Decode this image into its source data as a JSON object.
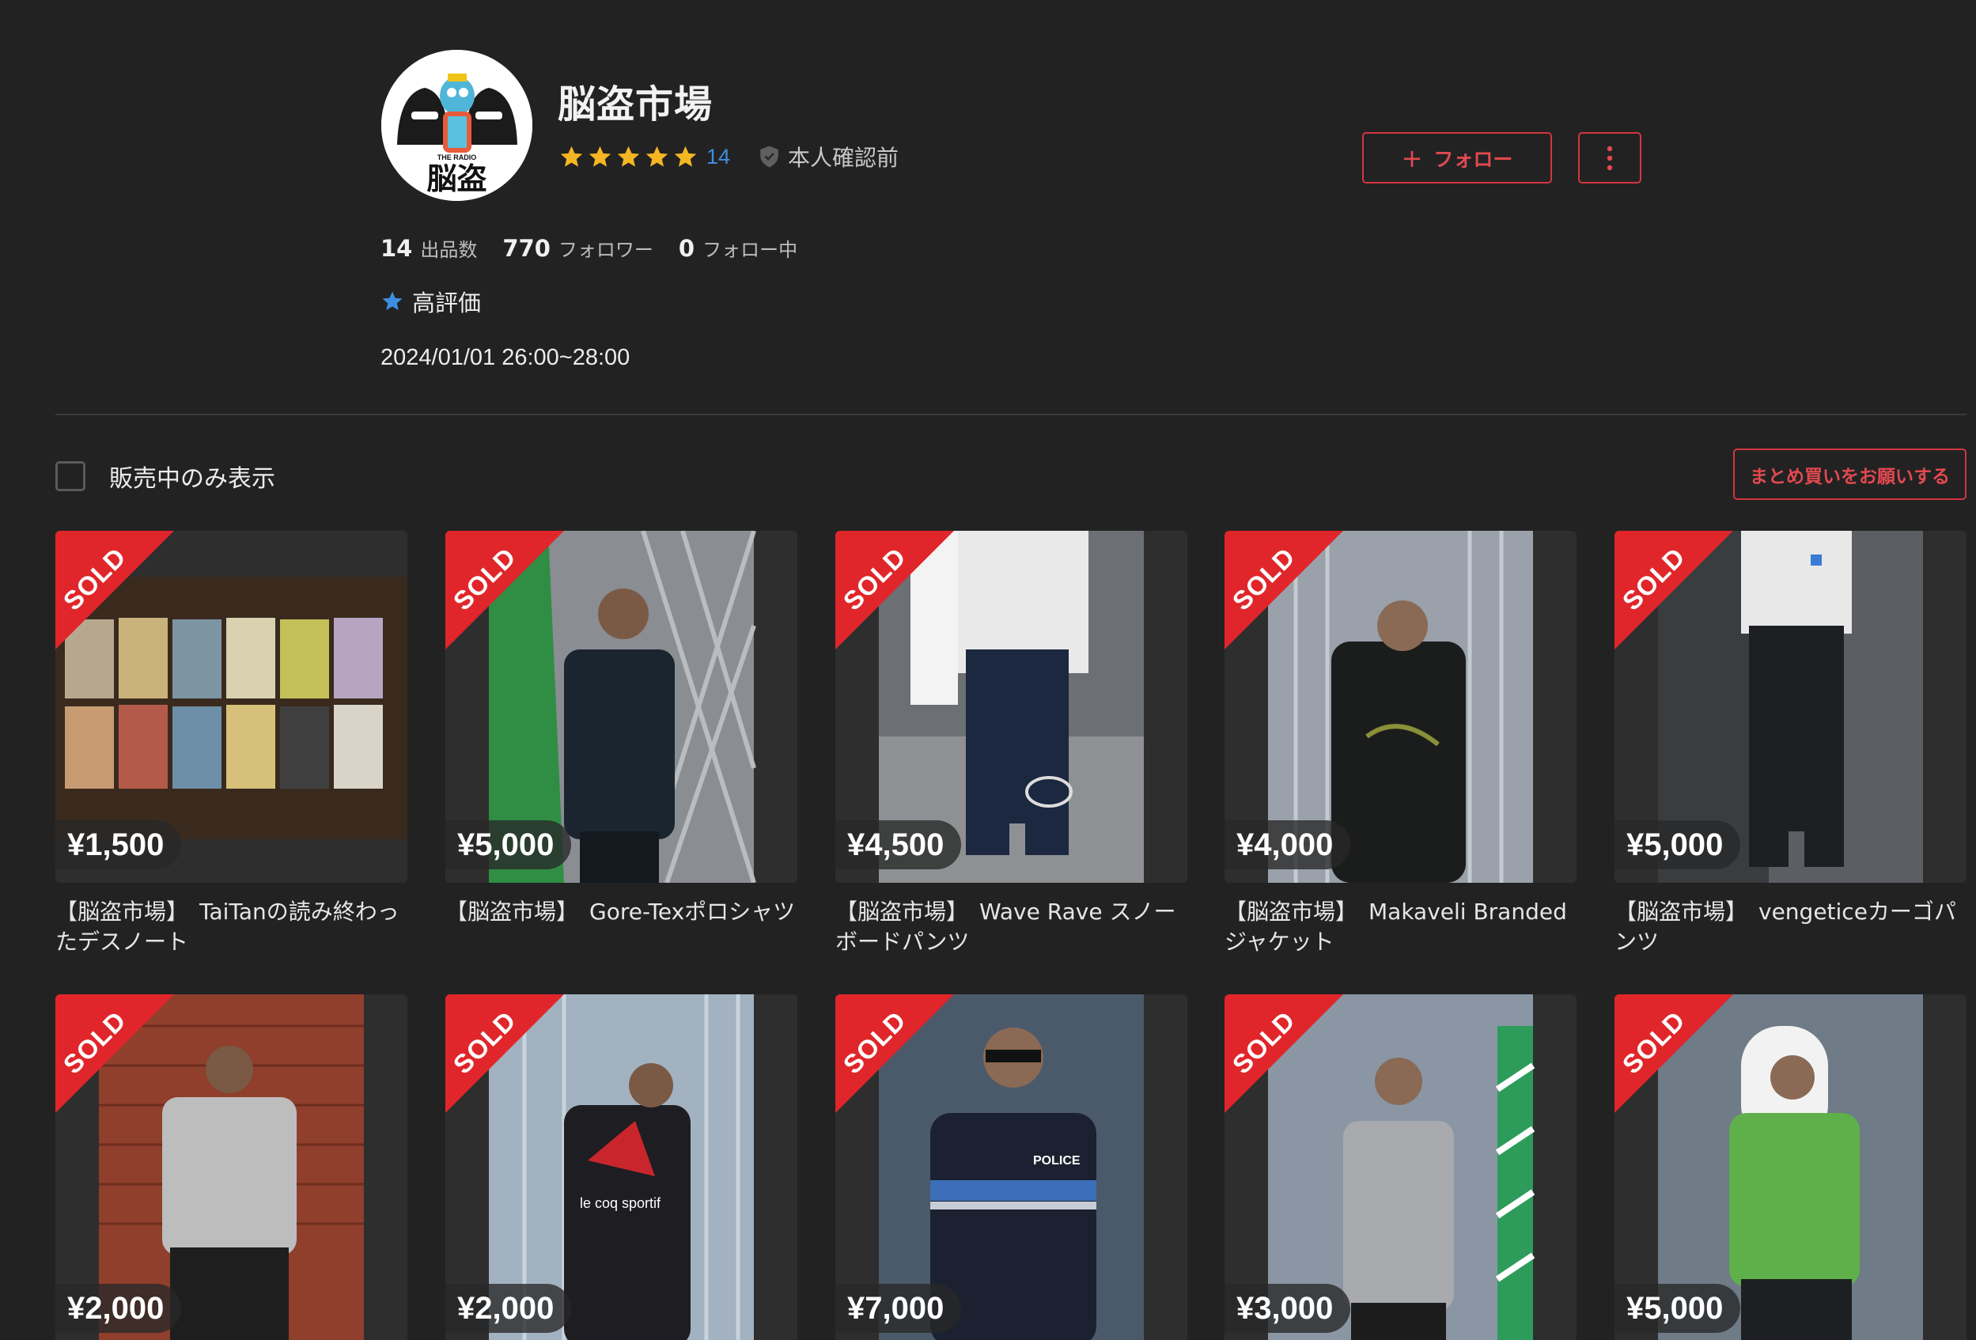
{
  "profile": {
    "name": "脳盗市場",
    "rating_count": "14",
    "verification": "本人確認前",
    "follow_label": "フォロー",
    "stats": [
      {
        "value": "14",
        "label": "出品数"
      },
      {
        "value": "770",
        "label": "フォロワー"
      },
      {
        "value": "0",
        "label": "フォロー中"
      }
    ],
    "badge": "高評価",
    "schedule": "2024/01/01 26:00~28:00",
    "avatar_text": "THE RADIO",
    "avatar_logo": "脳盗",
    "star_color": "#f5b623",
    "accent": "#d3363f"
  },
  "filter": {
    "checkbox_label": "販売中のみ表示",
    "checked": false
  },
  "bulk_button": "まとめ買いをお願いする",
  "sold_label": "SOLD",
  "items": [
    {
      "price": "¥1,500",
      "title": "【脳盗市場】　TaiTanの読み終わったデスノート"
    },
    {
      "price": "¥5,000",
      "title": "【脳盗市場】　Gore-Texポロシャツ"
    },
    {
      "price": "¥4,500",
      "title": "【脳盗市場】　Wave Rave スノーボードパンツ"
    },
    {
      "price": "¥4,000",
      "title": "【脳盗市場】　Makaveli Branded ジャケット"
    },
    {
      "price": "¥5,000",
      "title": "【脳盗市場】　vengeticeカーゴパンツ"
    },
    {
      "price": "¥2,000",
      "title": ""
    },
    {
      "price": "¥2,000",
      "title": ""
    },
    {
      "price": "¥7,000",
      "title": ""
    },
    {
      "price": "¥3,000",
      "title": ""
    },
    {
      "price": "¥5,000",
      "title": ""
    }
  ],
  "photo_text": {
    "item2_jacket": "le coq sportif",
    "item3_jacket": "POLICE"
  }
}
